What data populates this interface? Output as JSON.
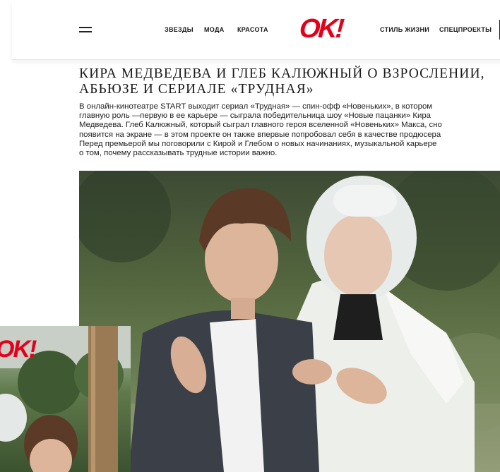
{
  "header": {
    "nav_left": [
      "ЗВЕЗДЫ",
      "МОДА",
      "КРАСОТА"
    ],
    "logo": "OK!",
    "nav_right": [
      "СТИЛЬ ЖИЗНИ",
      "СПЕЦПРОЕКТЫ"
    ]
  },
  "article": {
    "title_line1": "КИРА МЕДВЕДЕВА И ГЛЕБ КАЛЮЖНЫЙ О ВЗРОСЛЕНИИ,",
    "title_line2": "АБЬЮЗЕ И СЕРИАЛЕ «ТРУДНАЯ»",
    "lead_lines": [
      "В онлайн-кинотеатре START выходит сериал «Трудная» — спин-офф «Новеньких», в котором",
      "главную роль —первую в ее карьере — сыграла победительница шоу «Новые пацанки» Кира",
      "Медведева. Глеб Калюжный, который сыграл главного героя вселенной «Новеньких» Макса, сно",
      "появится на экране — в этом проекте он также впервые попробовал себя в качестве продюсера",
      "Перед премьерой мы поговорили с Кирой и Глебом о новых начинаниях, музыкальной карьере",
      "о том, почему рассказывать трудные истории важно."
    ]
  },
  "inset": {
    "logo": "OK!"
  }
}
